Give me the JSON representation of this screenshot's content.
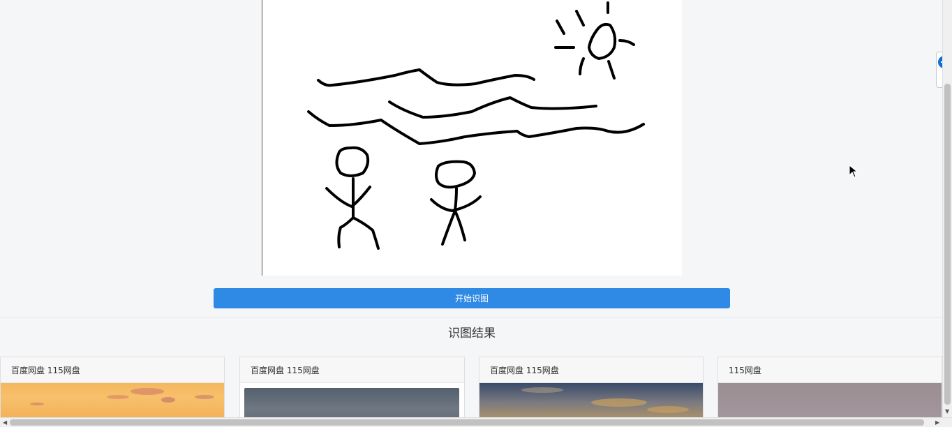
{
  "recognize_button": {
    "label": "开始识图"
  },
  "results": {
    "title": "识图结果",
    "cards": [
      {
        "header": "百度网盘 115网盘"
      },
      {
        "header": "百度网盘 115网盘"
      },
      {
        "header": "百度网盘 115网盘"
      },
      {
        "header": "115网盘"
      }
    ]
  },
  "colors": {
    "accent_button": "#2f8ae5",
    "page_background": "#f5f6f7",
    "canvas_background": "#ffffff",
    "side_widget_icon": "#0e6fd8"
  },
  "icons": {
    "side_widget": "teamviewer-icon",
    "scroll_down": "arrow-down-icon",
    "scroll_left": "arrow-left-icon",
    "scroll_right": "arrow-right-icon",
    "cursor": "mouse-cursor-icon"
  }
}
